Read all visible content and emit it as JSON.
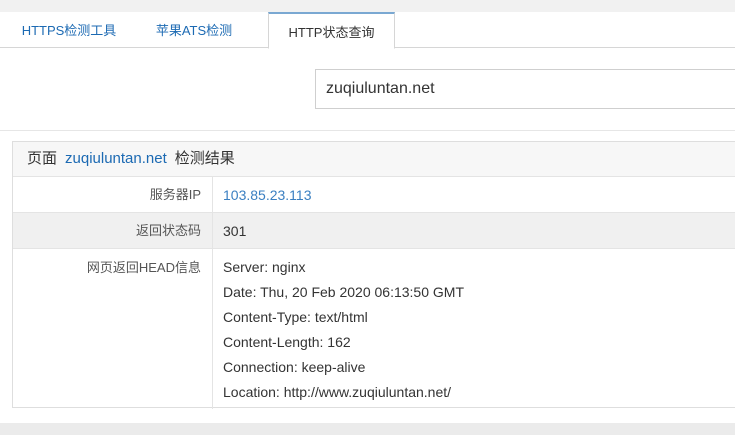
{
  "tabs": [
    {
      "label": "HTTPS检测工具"
    },
    {
      "label": "苹果ATS检测"
    },
    {
      "label": "HTTP状态查询"
    }
  ],
  "search": {
    "value": "zuqiuluntan.net"
  },
  "result": {
    "prefix": "页面",
    "host": "zuqiuluntan.net",
    "suffix": "检测结果",
    "rows": {
      "server_ip": {
        "label": "服务器IP",
        "value": "103.85.23.113"
      },
      "status": {
        "label": "返回状态码",
        "value": "301"
      },
      "head": {
        "label": "网页返回HEAD信息",
        "lines": [
          "Server: nginx",
          "Date: Thu, 20 Feb 2020 06:13:50 GMT",
          "Content-Type: text/html",
          "Content-Length: 162",
          "Connection: keep-alive",
          "Location: http://www.zuqiuluntan.net/"
        ]
      }
    }
  },
  "colors": {
    "link": "#1c6ab3",
    "ip": "#3a7fc1",
    "border": "#dedede"
  }
}
